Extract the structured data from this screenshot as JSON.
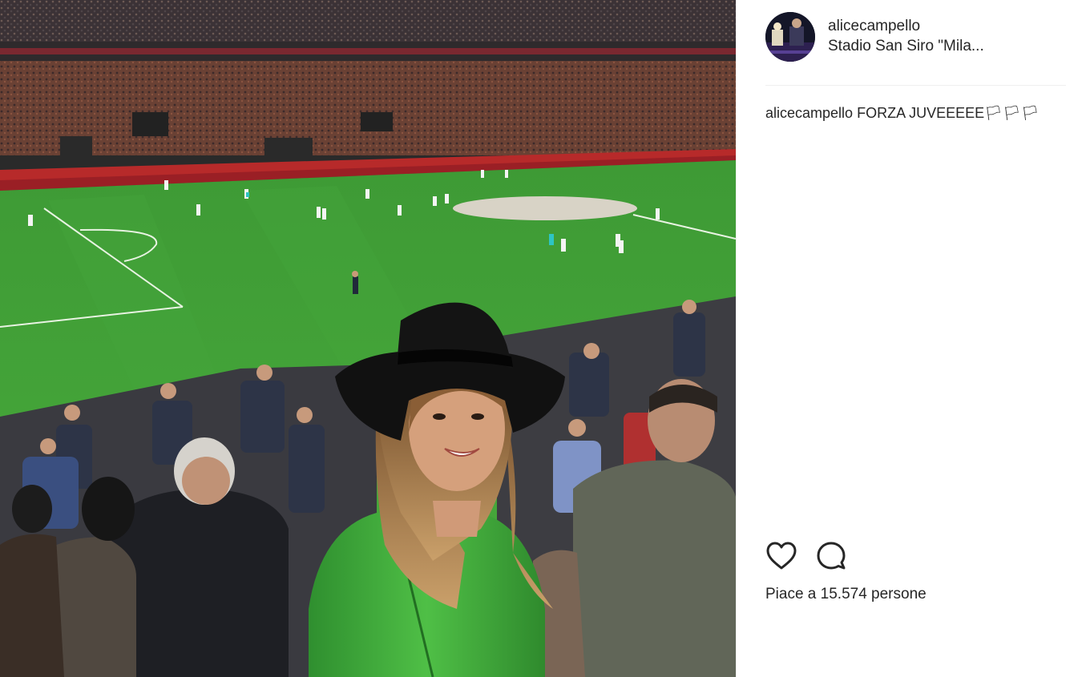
{
  "post": {
    "photo_alt": "",
    "author": {
      "username": "alicecampello",
      "location": "Stadio San Siro \"Mila..."
    },
    "caption": {
      "username": "alicecampello",
      "text": "FORZA JUVEEEEE🏳🏳🏳"
    },
    "actions": {
      "like_icon": "heart-icon",
      "comment_icon": "comment-icon"
    },
    "likes_text": "Piace a 15.574 persone"
  },
  "colors": {
    "text": "#262626",
    "divider": "#efefef",
    "pitch": "#3f9b36",
    "jacket": "#3faa3a"
  }
}
